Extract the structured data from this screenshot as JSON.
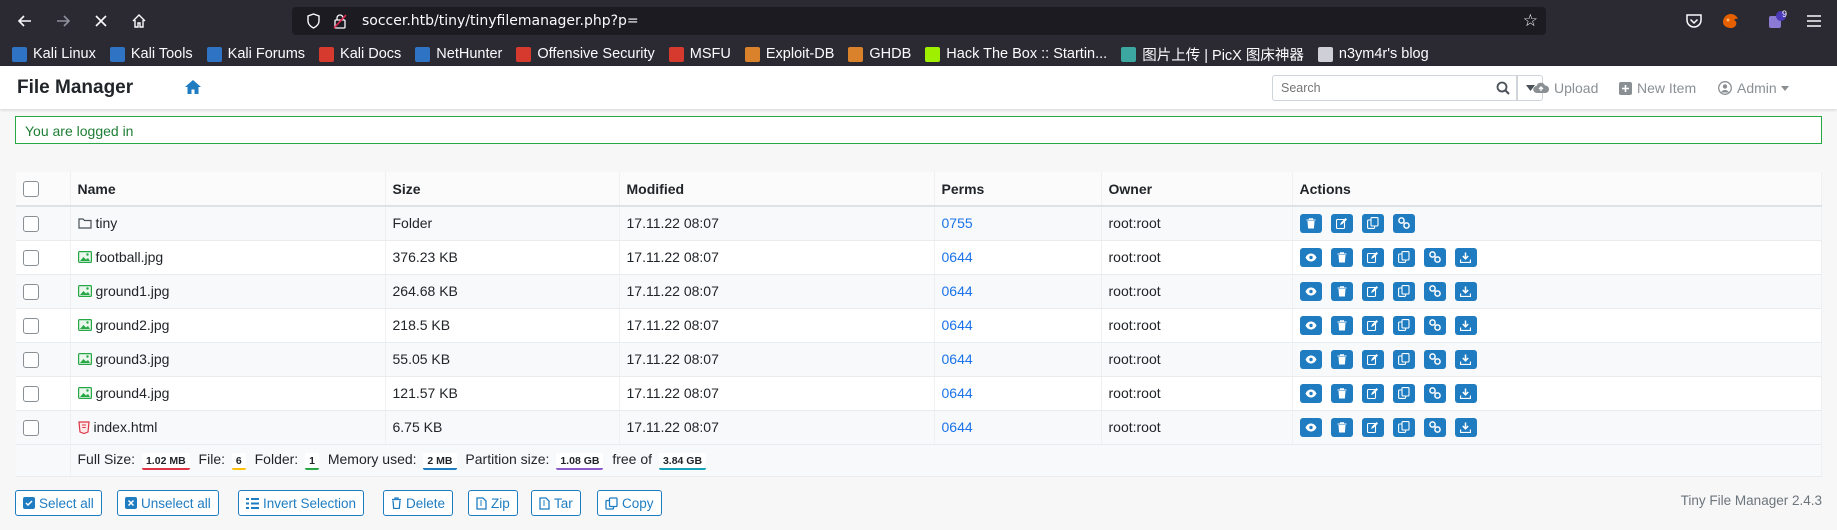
{
  "browser": {
    "url": "soccer.htb/tiny/tinyfilemanager.php?p=",
    "extensions_badge": "9",
    "bookmarks": [
      {
        "label": "Kali Linux",
        "color": "#2f73c5"
      },
      {
        "label": "Kali Tools",
        "color": "#2f73c5"
      },
      {
        "label": "Kali Forums",
        "color": "#2f73c5"
      },
      {
        "label": "Kali Docs",
        "color": "#d63a2f"
      },
      {
        "label": "NetHunter",
        "color": "#2f73c5"
      },
      {
        "label": "Offensive Security",
        "color": "#d63a2f"
      },
      {
        "label": "MSFU",
        "color": "#d63a2f"
      },
      {
        "label": "Exploit-DB",
        "color": "#d9822b"
      },
      {
        "label": "GHDB",
        "color": "#d9822b"
      },
      {
        "label": "Hack The Box :: Startin...",
        "color": "#9fef00"
      },
      {
        "label": "图片上传 | PicX 图床神器",
        "color": "#3ba7a0"
      },
      {
        "label": "n3ym4r's blog",
        "color": "#cfcfd8"
      }
    ]
  },
  "navbar": {
    "brand": "File Manager",
    "search_placeholder": "Search",
    "upload_label": "Upload",
    "new_item_label": "New Item",
    "admin_label": "Admin"
  },
  "alert": {
    "text": "You are logged in"
  },
  "table": {
    "headers": {
      "name": "Name",
      "size": "Size",
      "modified": "Modified",
      "perms": "Perms",
      "owner": "Owner",
      "actions": "Actions"
    },
    "rows": [
      {
        "name": "tiny",
        "type": "folder",
        "size": "Folder",
        "modified": "17.11.22 08:07",
        "perms": "0755",
        "owner": "root:root"
      },
      {
        "name": "football.jpg",
        "type": "image",
        "size": "376.23 KB",
        "modified": "17.11.22 08:07",
        "perms": "0644",
        "owner": "root:root"
      },
      {
        "name": "ground1.jpg",
        "type": "image",
        "size": "264.68 KB",
        "modified": "17.11.22 08:07",
        "perms": "0644",
        "owner": "root:root"
      },
      {
        "name": "ground2.jpg",
        "type": "image",
        "size": "218.5 KB",
        "modified": "17.11.22 08:07",
        "perms": "0644",
        "owner": "root:root"
      },
      {
        "name": "ground3.jpg",
        "type": "image",
        "size": "55.05 KB",
        "modified": "17.11.22 08:07",
        "perms": "0644",
        "owner": "root:root"
      },
      {
        "name": "ground4.jpg",
        "type": "image",
        "size": "121.57 KB",
        "modified": "17.11.22 08:07",
        "perms": "0644",
        "owner": "root:root"
      },
      {
        "name": "index.html",
        "type": "html",
        "size": "6.75 KB",
        "modified": "17.11.22 08:07",
        "perms": "0644",
        "owner": "root:root"
      }
    ],
    "summary": {
      "full_size_label": "Full Size:",
      "full_size": "1.02 MB",
      "file_label": "File:",
      "file_count": "6",
      "folder_label": "Folder:",
      "folder_count": "1",
      "memory_label": "Memory used:",
      "memory": "2 MB",
      "partition_label": "Partition size:",
      "partition": "1.08 GB",
      "free_of_label": "free of",
      "total": "3.84 GB"
    }
  },
  "bottom": {
    "select_all": "Select all",
    "unselect_all": "Unselect all",
    "invert": "Invert Selection",
    "delete": "Delete",
    "zip": "Zip",
    "tar": "Tar",
    "copy": "Copy",
    "version": "Tiny File Manager 2.4.3"
  },
  "colors": {
    "accent": "#1f7cc1",
    "success": "#28a745",
    "perm_link": "#1a73e8"
  }
}
